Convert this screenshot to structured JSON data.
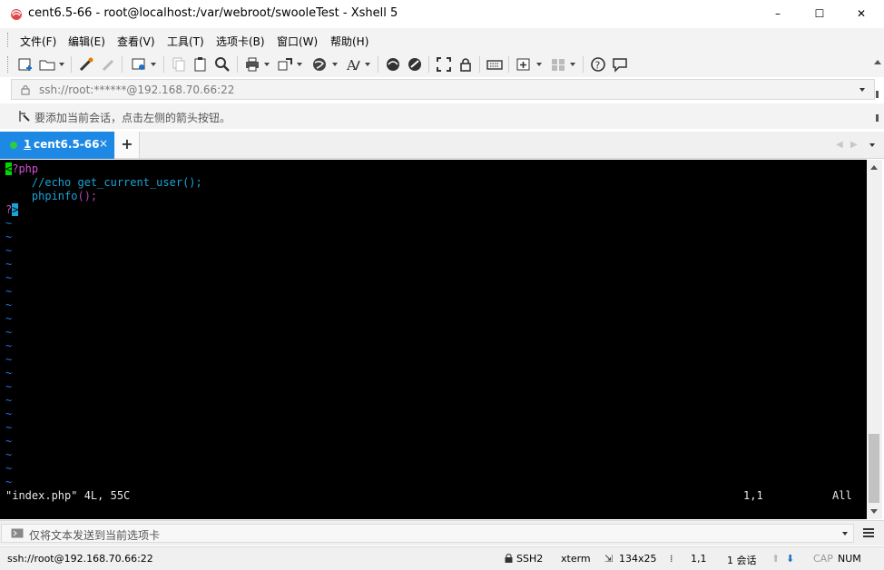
{
  "window": {
    "title": "cent6.5-66 - root@localhost:/var/webroot/swooleTest - Xshell 5",
    "controls": [
      "–",
      "☐",
      "✕"
    ]
  },
  "menu": [
    {
      "label": "文件(F)"
    },
    {
      "label": "编辑(E)"
    },
    {
      "label": "查看(V)"
    },
    {
      "label": "工具(T)"
    },
    {
      "label": "选项卡(B)"
    },
    {
      "label": "窗口(W)"
    },
    {
      "label": "帮助(H)"
    }
  ],
  "toolbar": {
    "icons": [
      "new-session-icon",
      "open-folder-icon",
      "reconnect-icon",
      "disconnect-icon",
      "properties-icon",
      "copy-icon",
      "paste-icon",
      "find-icon",
      "print-icon",
      "transfer-icon",
      "globe-icon",
      "font-icon",
      "xftp-icon",
      "xshell-icon",
      "fullscreen-icon",
      "lock-icon",
      "keyboard-icon",
      "compose-icon",
      "layout-icon",
      "help-icon",
      "chat-icon"
    ]
  },
  "address": {
    "value": "ssh://root:******@192.168.70.66:22"
  },
  "hint": {
    "text": "要添加当前会话，点击左侧的箭头按钮。"
  },
  "tabs": [
    {
      "number": "1",
      "label": "cent6.5-66",
      "close": "×",
      "active": true
    }
  ],
  "new_tab": "+",
  "terminal": {
    "lines": [
      {
        "parts": [
          {
            "text": "<",
            "color": "#000000",
            "bg": "#00d800"
          },
          {
            "text": "?php",
            "color": "#d44fd4"
          }
        ]
      },
      {
        "parts": [
          {
            "text": "    //echo get_current_user();",
            "color": "#1aa3d6"
          }
        ]
      },
      {
        "parts": [
          {
            "text": "    phpinfo",
            "color": "#1aa3d6"
          },
          {
            "text": "();",
            "color": "#b545b5"
          }
        ]
      },
      {
        "parts": [
          {
            "text": "?",
            "color": "#d44fd4"
          },
          {
            "text": ">",
            "color": "#000000",
            "bg": "#1aa3d6"
          }
        ]
      }
    ],
    "tilde": "~",
    "tilde_count": 20,
    "tilde_color": "#2b6ee0",
    "status_left": "\"index.php\" 4L, 55C",
    "status_pos": "1,1",
    "status_all": "All"
  },
  "send_bar": {
    "placeholder": "仅将文本发送到当前选项卡"
  },
  "statusbar": {
    "session": "ssh://root@192.168.70.66:22",
    "protocol": "SSH2",
    "terminal_type": "xterm",
    "size": "134x25",
    "cursor": "1,1",
    "sessions": "1 会话",
    "cap": "CAP",
    "num": "NUM"
  },
  "colors": {
    "accent": "#1e88e5",
    "terminal_bg": "#000000"
  }
}
